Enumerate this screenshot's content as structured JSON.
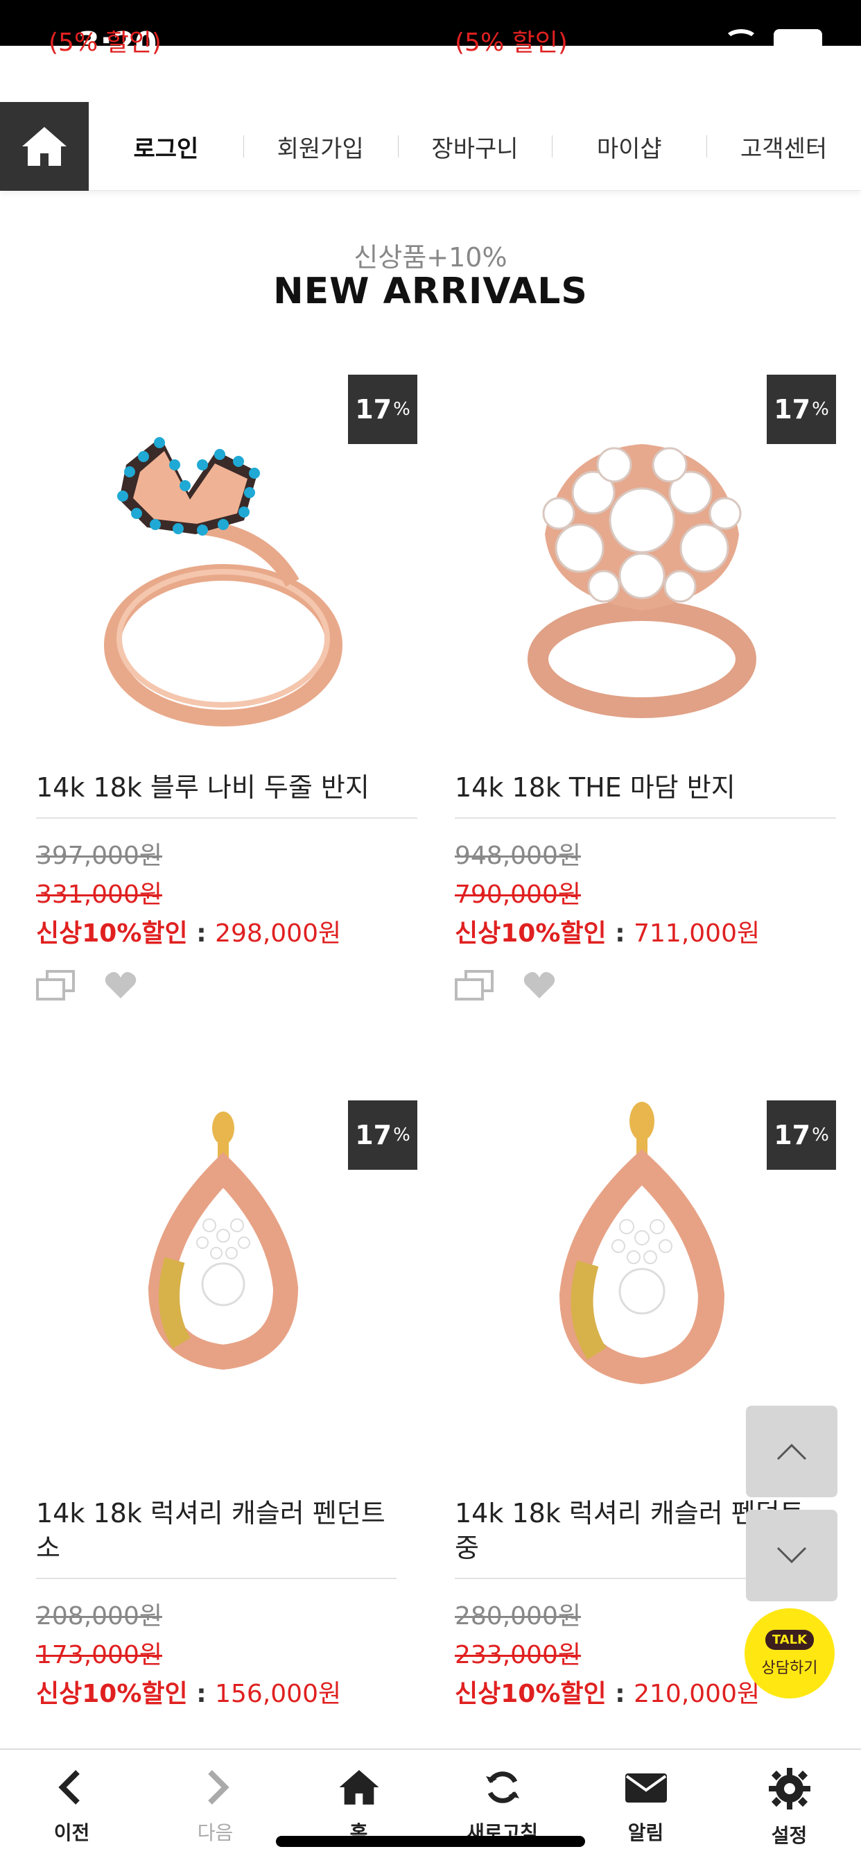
{
  "status_bar": {
    "time": "3:20"
  },
  "promo_clipped": {
    "left": "(5% 할인)",
    "right": "(5% 할인)"
  },
  "nav": {
    "items": [
      {
        "label": "로그인"
      },
      {
        "label": "회원가입"
      },
      {
        "label": "장바구니"
      },
      {
        "label": "마이샵"
      },
      {
        "label": "고객센터"
      }
    ]
  },
  "section": {
    "subtitle": "신상품+10%",
    "title": "NEW ARRIVALS"
  },
  "products": [
    {
      "badge": "17",
      "badge_unit": "%",
      "name": "14k 18k 블루 나비 두줄 반지",
      "original_price": "397,000원",
      "sale_price": "331,000원",
      "promo_label": "신상10%할인",
      "promo_sep": " : ",
      "promo_price": "298,000원"
    },
    {
      "badge": "17",
      "badge_unit": "%",
      "name": "14k 18k THE 마담 반지",
      "original_price": "948,000원",
      "sale_price": "790,000원",
      "promo_label": "신상10%할인",
      "promo_sep": " : ",
      "promo_price": "711,000원"
    },
    {
      "badge": "17",
      "badge_unit": "%",
      "name": "14k 18k 럭셔리 캐슬러 펜던트 소",
      "original_price": "208,000원",
      "sale_price": "173,000원",
      "promo_label": "신상10%할인",
      "promo_sep": " : ",
      "promo_price": "156,000원"
    },
    {
      "badge": "17",
      "badge_unit": "%",
      "name": "14k 18k 럭셔리 캐슬러 펜던트 중",
      "original_price": "280,000원",
      "sale_price": "233,000원",
      "promo_label": "신상10%할인",
      "promo_sep": " : ",
      "promo_price": "210,000원"
    }
  ],
  "talk_button": {
    "badge": "TALK",
    "label": "상담하기"
  },
  "tabbar": {
    "items": [
      {
        "label": "이전"
      },
      {
        "label": "다음"
      },
      {
        "label": "홈"
      },
      {
        "label": "새로고침"
      },
      {
        "label": "알림"
      },
      {
        "label": "설정"
      }
    ]
  },
  "colors": {
    "accent_red": "#e02020",
    "dark": "#333333",
    "kakao_yellow": "#ffe812"
  }
}
